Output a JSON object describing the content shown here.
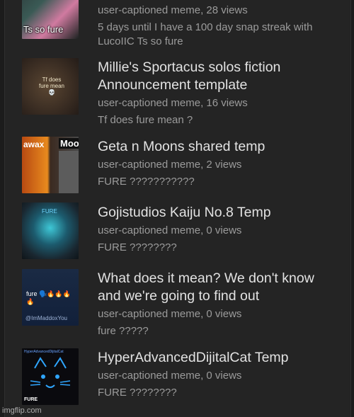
{
  "items": [
    {
      "thumb_caption": "Ts so fure",
      "meta": "user-captioned meme, 28 views",
      "desc": "5 days until I have a 100 day snap streak with LucoIIC Ts so fure"
    },
    {
      "title": "Millie's Sportacus solos fiction Announcement template",
      "thumb_caption": "Tf does fure mean 💀",
      "meta": "user-captioned meme, 16 views",
      "desc": "Tf does fure mean ?"
    },
    {
      "title": "Geta n Moons shared temp",
      "thumb_caption_1": "awax",
      "thumb_caption_2": "Moo",
      "meta": "user-captioned meme, 2 views",
      "desc": "FURE ???????????"
    },
    {
      "title": "Gojistudios Kaiju No.8 Temp",
      "thumb_caption": "FURE",
      "meta": "user-captioned meme, 0 views",
      "desc": "FURE ????????"
    },
    {
      "title": "What does it mean? We don't know and we're going to find out",
      "thumb_caption": "fure 🗣️🔥🔥🔥🔥",
      "thumb_handle": "@ImMaddoxYou",
      "meta": "user-captioned meme, 0 views",
      "desc": "fure ?????"
    },
    {
      "title": "HyperAdvancedDijitalCat Temp",
      "thumb_caption_top": "HyperAdvancedDijitalCat",
      "thumb_caption": "FURE",
      "meta": "user-captioned meme, 0 views",
      "desc": "FURE ????????"
    }
  ],
  "watermark": "imgflip.com"
}
